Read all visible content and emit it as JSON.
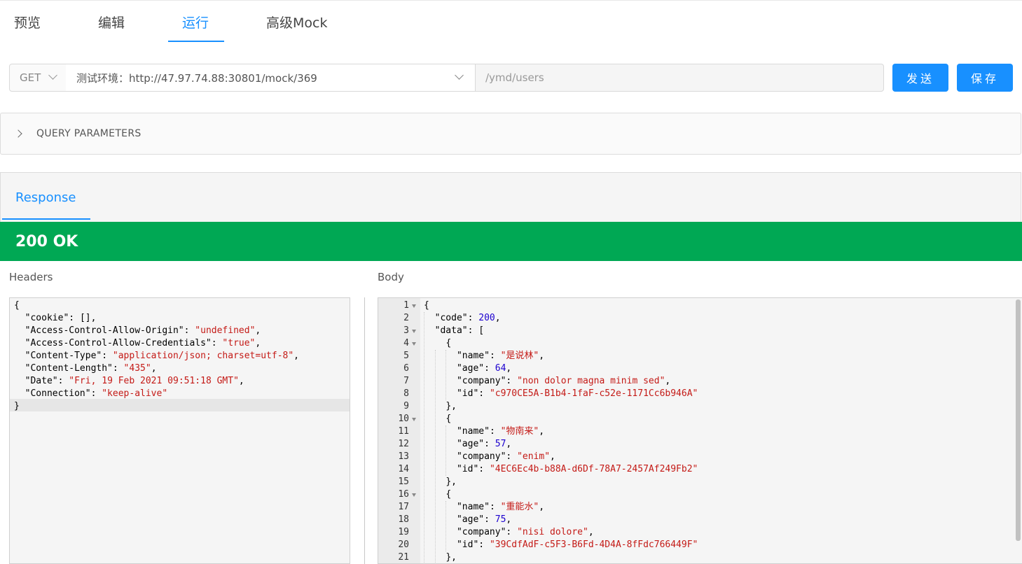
{
  "tabs": [
    {
      "label": "预览"
    },
    {
      "label": "编辑"
    },
    {
      "label": "运行"
    },
    {
      "label": "高级Mock"
    }
  ],
  "active_tab": "运行",
  "request": {
    "method": "GET",
    "environment": "测试环境：http://47.97.74.88:30801/mock/369",
    "path": "/ymd/users"
  },
  "buttons": {
    "send": "发送",
    "save": "保存"
  },
  "query_parameters": {
    "label": "QUERY PARAMETERS"
  },
  "response": {
    "tab_label": "Response",
    "status": "200 OK",
    "status_color": "#00a854",
    "headers_label": "Headers",
    "body_label": "Body"
  },
  "headers_json": [
    {
      "text": "{"
    },
    {
      "key": "\"cookie\"",
      "val": "[]",
      "vtype": "k",
      "tail": ","
    },
    {
      "key": "\"Access-Control-Allow-Origin\"",
      "val": "\"undefined\"",
      "vtype": "s",
      "tail": ","
    },
    {
      "key": "\"Access-Control-Allow-Credentials\"",
      "val": "\"true\"",
      "vtype": "s",
      "tail": ","
    },
    {
      "key": "\"Content-Type\"",
      "val": "\"application/json; charset=utf-8\"",
      "vtype": "s",
      "tail": ","
    },
    {
      "key": "\"Content-Length\"",
      "val": "\"435\"",
      "vtype": "s",
      "tail": ","
    },
    {
      "key": "\"Date\"",
      "val": "\"Fri, 19 Feb 2021 09:51:18 GMT\"",
      "vtype": "s",
      "tail": ","
    },
    {
      "key": "\"Connection\"",
      "val": "\"keep-alive\"",
      "vtype": "s",
      "tail": ""
    },
    {
      "text": "}"
    }
  ],
  "body_json": [
    {
      "ln": "1",
      "fold": true,
      "indent": 0,
      "text": "{"
    },
    {
      "ln": "2",
      "fold": false,
      "indent": 1,
      "key": "\"code\"",
      "val": "200",
      "vtype": "n",
      "tail": ","
    },
    {
      "ln": "3",
      "fold": true,
      "indent": 1,
      "key": "\"data\"",
      "val": "[",
      "vtype": "k",
      "tail": ""
    },
    {
      "ln": "4",
      "fold": true,
      "indent": 2,
      "text": "{"
    },
    {
      "ln": "5",
      "fold": false,
      "indent": 3,
      "key": "\"name\"",
      "val": "\"是说林\"",
      "vtype": "s",
      "tail": ","
    },
    {
      "ln": "6",
      "fold": false,
      "indent": 3,
      "key": "\"age\"",
      "val": "64",
      "vtype": "n",
      "tail": ","
    },
    {
      "ln": "7",
      "fold": false,
      "indent": 3,
      "key": "\"company\"",
      "val": "\"non dolor magna minim sed\"",
      "vtype": "s",
      "tail": ","
    },
    {
      "ln": "8",
      "fold": false,
      "indent": 3,
      "key": "\"id\"",
      "val": "\"c970CE5A-B1b4-1faF-c52e-1171Cc6b946A\"",
      "vtype": "s",
      "tail": ""
    },
    {
      "ln": "9",
      "fold": false,
      "indent": 2,
      "text": "},"
    },
    {
      "ln": "10",
      "fold": true,
      "indent": 2,
      "text": "{"
    },
    {
      "ln": "11",
      "fold": false,
      "indent": 3,
      "key": "\"name\"",
      "val": "\"物南来\"",
      "vtype": "s",
      "tail": ","
    },
    {
      "ln": "12",
      "fold": false,
      "indent": 3,
      "key": "\"age\"",
      "val": "57",
      "vtype": "n",
      "tail": ","
    },
    {
      "ln": "13",
      "fold": false,
      "indent": 3,
      "key": "\"company\"",
      "val": "\"enim\"",
      "vtype": "s",
      "tail": ","
    },
    {
      "ln": "14",
      "fold": false,
      "indent": 3,
      "key": "\"id\"",
      "val": "\"4EC6Ec4b-b88A-d6Df-78A7-2457Af249Fb2\"",
      "vtype": "s",
      "tail": ""
    },
    {
      "ln": "15",
      "fold": false,
      "indent": 2,
      "text": "},"
    },
    {
      "ln": "16",
      "fold": true,
      "indent": 2,
      "text": "{"
    },
    {
      "ln": "17",
      "fold": false,
      "indent": 3,
      "key": "\"name\"",
      "val": "\"重能水\"",
      "vtype": "s",
      "tail": ","
    },
    {
      "ln": "18",
      "fold": false,
      "indent": 3,
      "key": "\"age\"",
      "val": "75",
      "vtype": "n",
      "tail": ","
    },
    {
      "ln": "19",
      "fold": false,
      "indent": 3,
      "key": "\"company\"",
      "val": "\"nisi dolore\"",
      "vtype": "s",
      "tail": ","
    },
    {
      "ln": "20",
      "fold": false,
      "indent": 3,
      "key": "\"id\"",
      "val": "\"39CdfAdF-c5F3-B6Fd-4D4A-8fFdc766449F\"",
      "vtype": "s",
      "tail": ""
    },
    {
      "ln": "21",
      "fold": false,
      "indent": 2,
      "text": "},"
    }
  ]
}
